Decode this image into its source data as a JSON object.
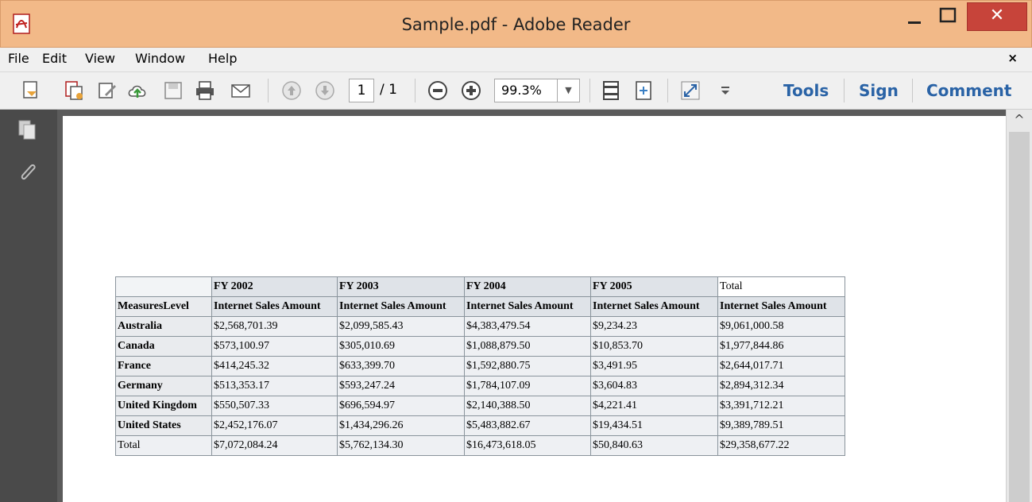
{
  "window": {
    "title": "Sample.pdf - Adobe Reader",
    "close_glyph": "✕",
    "colors": {
      "titlebar": "#f2b988",
      "close": "#c7443a",
      "link": "#2a63a6"
    }
  },
  "menu": {
    "items": [
      "File",
      "Edit",
      "View",
      "Window",
      "Help"
    ],
    "close_glyph": "×"
  },
  "toolbar": {
    "icons": [
      "create-pdf-icon",
      "combine-files-icon",
      "edit-icon",
      "cloud-upload-icon",
      "save-icon",
      "print-icon",
      "email-icon",
      "previous-page-icon",
      "next-page-icon",
      "zoom-out-icon",
      "zoom-in-icon",
      "fit-page-icon",
      "fit-width-icon",
      "fullscreen-icon",
      "more-tools-icon"
    ],
    "page_current": "1",
    "page_total": "/ 1",
    "zoom": "99.3%",
    "tools_label": "Tools",
    "sign_label": "Sign",
    "comment_label": "Comment"
  },
  "navpane": {
    "icons": [
      "page-thumbnails-icon",
      "attachments-icon"
    ]
  },
  "table": {
    "year_headers": [
      "FY 2002",
      "FY 2003",
      "FY 2004",
      "FY 2005",
      "Total"
    ],
    "measures_label": "MeasuresLevel",
    "measure": "Internet Sales Amount",
    "rows": [
      {
        "country": "Australia",
        "values": [
          "$2,568,701.39",
          "$2,099,585.43",
          "$4,383,479.54",
          "$9,234.23",
          "$9,061,000.58"
        ]
      },
      {
        "country": "Canada",
        "values": [
          "$573,100.97",
          "$305,010.69",
          "$1,088,879.50",
          "$10,853.70",
          "$1,977,844.86"
        ]
      },
      {
        "country": "France",
        "values": [
          "$414,245.32",
          "$633,399.70",
          "$1,592,880.75",
          "$3,491.95",
          "$2,644,017.71"
        ]
      },
      {
        "country": "Germany",
        "values": [
          "$513,353.17",
          "$593,247.24",
          "$1,784,107.09",
          "$3,604.83",
          "$2,894,312.34"
        ]
      },
      {
        "country": "United Kingdom",
        "values": [
          "$550,507.33",
          "$696,594.97",
          "$2,140,388.50",
          "$4,221.41",
          "$3,391,712.21"
        ]
      },
      {
        "country": "United States",
        "values": [
          "$2,452,176.07",
          "$1,434,296.26",
          "$5,483,882.67",
          "$19,434.51",
          "$9,389,789.51"
        ]
      },
      {
        "country": "Total",
        "values": [
          "$7,072,084.24",
          "$5,762,134.30",
          "$16,473,618.05",
          "$50,840.63",
          "$29,358,677.22"
        ]
      }
    ]
  }
}
